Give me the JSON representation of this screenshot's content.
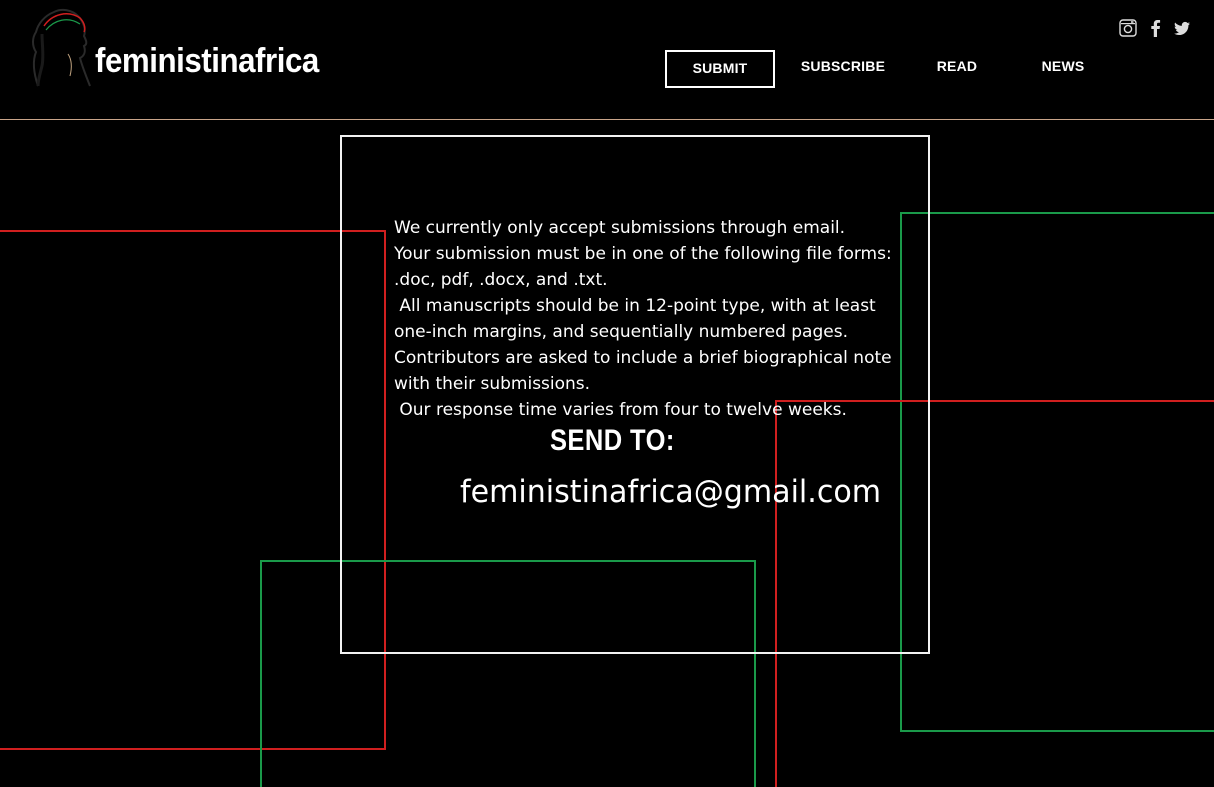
{
  "header": {
    "site_title": "feministinafrica",
    "logo_icon": "woman-headwrap-silhouette-icon",
    "nav": [
      {
        "label": "SUBMIT",
        "active": true
      },
      {
        "label": "SUBSCRIBE",
        "active": false
      },
      {
        "label": "READ",
        "active": false
      },
      {
        "label": "NEWS",
        "active": false
      }
    ],
    "social": [
      "instagram-icon",
      "facebook-icon",
      "twitter-icon"
    ],
    "divider_color": "#c9a58a"
  },
  "main": {
    "paragraphs": [
      "We currently only accept submissions through email.",
      "Your submission must be in one of the following file forms: .doc, pdf, .docx, and .txt.",
      " All manuscripts should be in 12-point type, with at least one-inch margins, and sequentially numbered pages.",
      "Contributors are asked to include a brief biographical note with their submissions.",
      " Our response time varies from four to twelve weeks."
    ],
    "send_to_label": "SEND TO:",
    "email": "feministinafrica@gmail.com"
  },
  "colors": {
    "background": "#000000",
    "accent_red": "#d01f1f",
    "accent_green": "#1a9a4a",
    "text": "#ffffff"
  }
}
